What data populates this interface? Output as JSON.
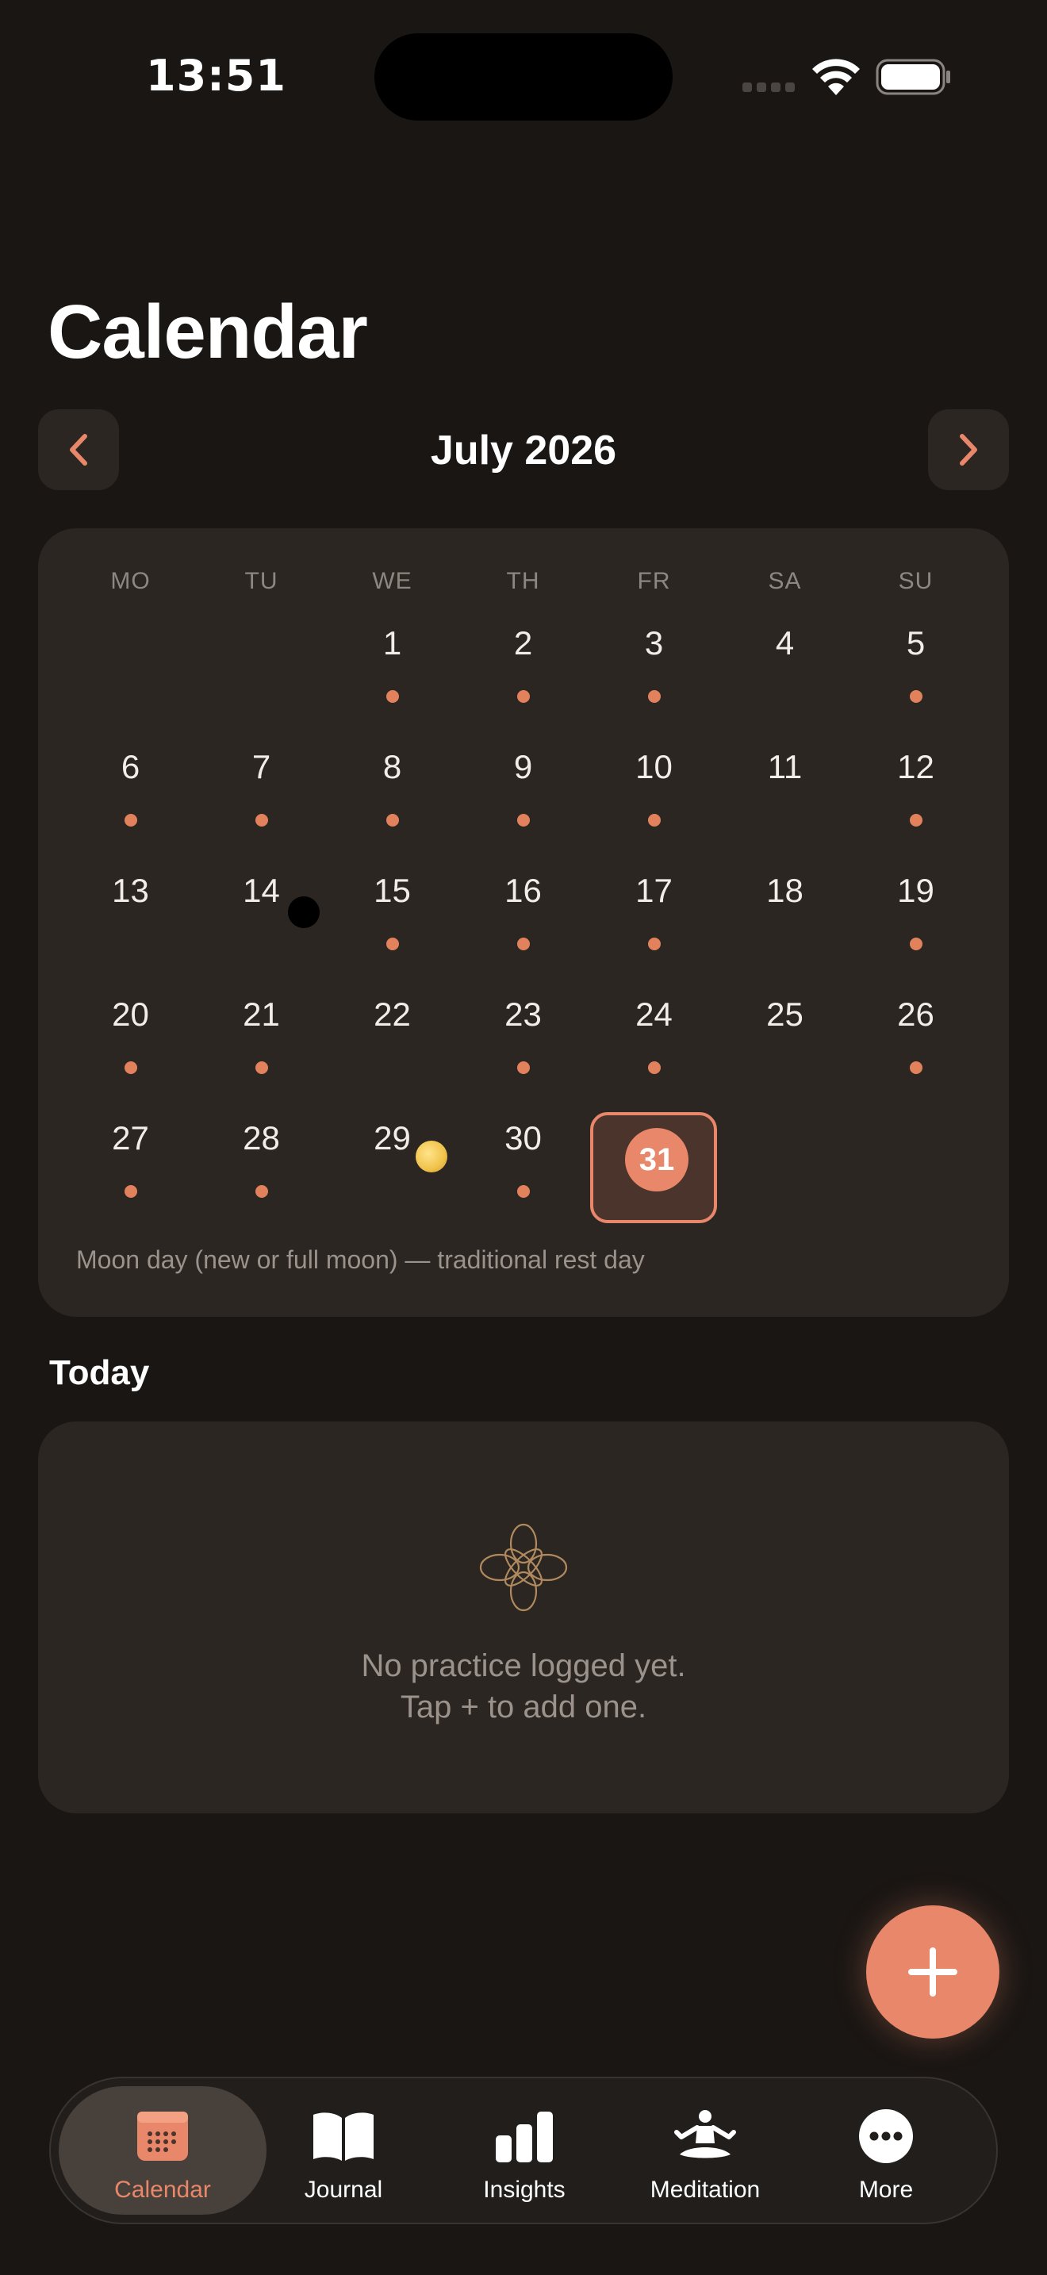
{
  "status_bar": {
    "time": "13:51"
  },
  "page_title": "Calendar",
  "month_nav": {
    "month_label": "July 2026"
  },
  "calendar": {
    "weekdays": [
      "MO",
      "TU",
      "WE",
      "TH",
      "FR",
      "SA",
      "SU"
    ],
    "weeks": [
      [
        {
          "day": ""
        },
        {
          "day": ""
        },
        {
          "day": "1",
          "logged": true
        },
        {
          "day": "2",
          "logged": true
        },
        {
          "day": "3",
          "logged": true
        },
        {
          "day": "4",
          "logged": false
        },
        {
          "day": "5",
          "logged": true
        }
      ],
      [
        {
          "day": "6",
          "logged": true
        },
        {
          "day": "7",
          "logged": true
        },
        {
          "day": "8",
          "logged": true
        },
        {
          "day": "9",
          "logged": true
        },
        {
          "day": "10",
          "logged": true
        },
        {
          "day": "11",
          "logged": false
        },
        {
          "day": "12",
          "logged": true
        }
      ],
      [
        {
          "day": "13",
          "logged": false
        },
        {
          "day": "14",
          "logged": false,
          "moon": "new"
        },
        {
          "day": "15",
          "logged": true
        },
        {
          "day": "16",
          "logged": true
        },
        {
          "day": "17",
          "logged": true
        },
        {
          "day": "18",
          "logged": false
        },
        {
          "day": "19",
          "logged": true
        }
      ],
      [
        {
          "day": "20",
          "logged": true
        },
        {
          "day": "21",
          "logged": true
        },
        {
          "day": "22",
          "logged": false
        },
        {
          "day": "23",
          "logged": true
        },
        {
          "day": "24",
          "logged": true
        },
        {
          "day": "25",
          "logged": false
        },
        {
          "day": "26",
          "logged": true
        }
      ],
      [
        {
          "day": "27",
          "logged": true
        },
        {
          "day": "28",
          "logged": true
        },
        {
          "day": "29",
          "logged": false,
          "moon": "full"
        },
        {
          "day": "30",
          "logged": true
        },
        {
          "day": "31",
          "logged": false,
          "today": true
        },
        {
          "day": ""
        },
        {
          "day": ""
        }
      ]
    ],
    "legend": "Moon day (new or full moon) — traditional rest day"
  },
  "today_section": {
    "title": "Today",
    "empty_line1": "No practice logged yet.",
    "empty_line2": "Tap + to add one."
  },
  "tabs": [
    {
      "label": "Calendar",
      "icon": "calendar-icon",
      "active": true
    },
    {
      "label": "Journal",
      "icon": "book-icon",
      "active": false
    },
    {
      "label": "Insights",
      "icon": "bar-chart-icon",
      "active": false
    },
    {
      "label": "Meditation",
      "icon": "meditation-icon",
      "active": false
    },
    {
      "label": "More",
      "icon": "more-icon",
      "active": false
    }
  ],
  "colors": {
    "accent": "#e8876a",
    "background": "#1a1613",
    "card": "#2b2622",
    "muted_text": "#9a928b"
  }
}
